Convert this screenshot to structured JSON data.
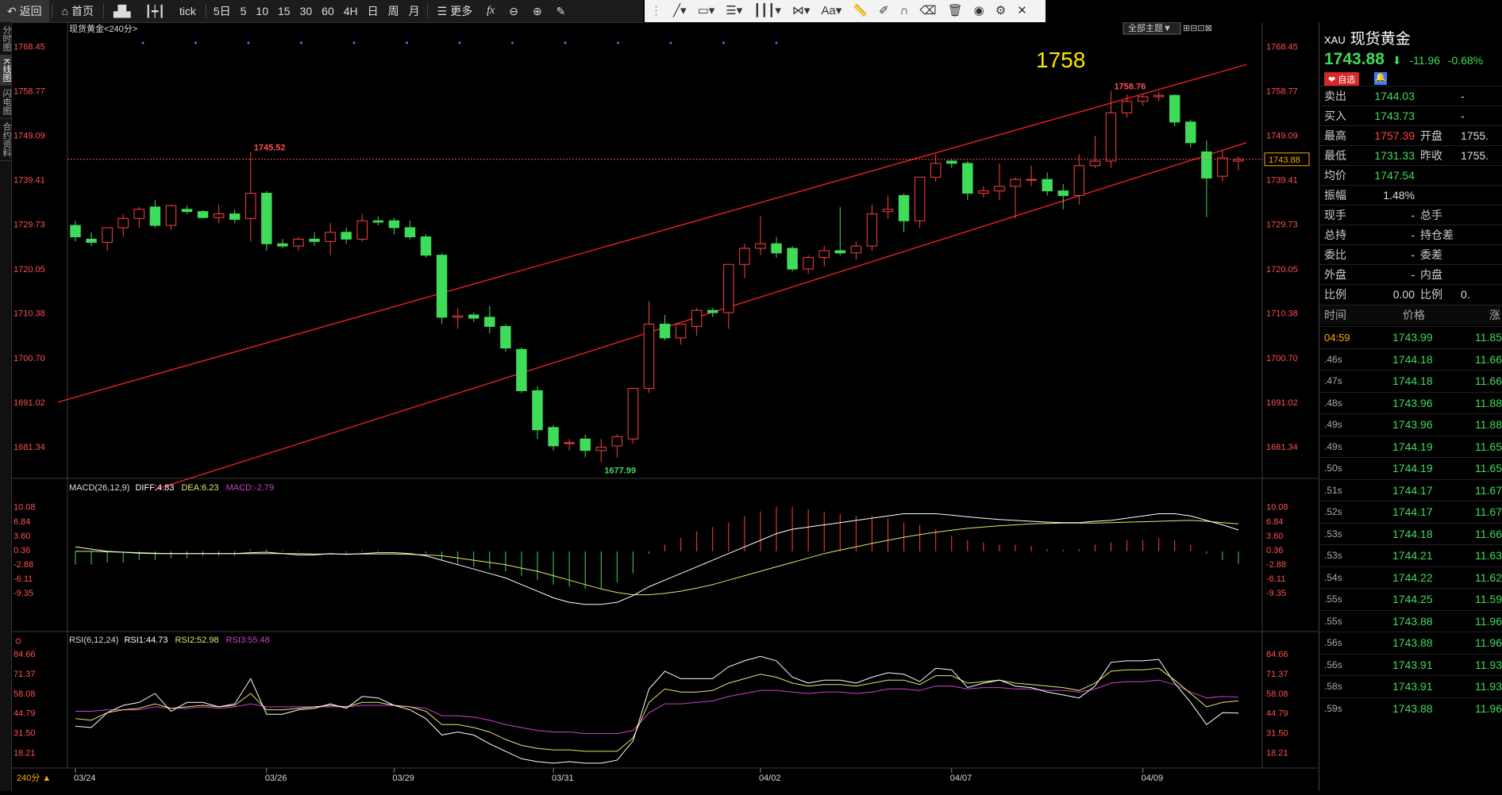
{
  "topbar": {
    "back": "返回",
    "home": "首页",
    "tick": "tick",
    "periods": [
      "5日",
      "5",
      "10",
      "15",
      "30",
      "60",
      "4H",
      "日",
      "周",
      "月"
    ],
    "more": "更多",
    "fx": "fx"
  },
  "drawbar": {
    "font_label": "Aa"
  },
  "left_tabs": [
    "分时图",
    "K线图",
    "闪电图",
    "合约资料"
  ],
  "chart": {
    "symbol_label": "现货黄金<240分>",
    "theme_button": "全部主题▼",
    "big_label": "1758",
    "high_label": "1758.76",
    "low_label": "1677.99",
    "prev_high_label": "1745.52",
    "current_price_tag": "1743.88",
    "price_axis": [
      "1768.45",
      "1758.77",
      "1749.09",
      "1739.41",
      "1729.73",
      "1720.05",
      "1710.38",
      "1700.70",
      "1691.02",
      "1681.34"
    ],
    "dates": [
      "03/24",
      "03/26",
      "03/29",
      "03/31",
      "04/02",
      "04/07",
      "04/09"
    ],
    "period_tag": "240分 ▲",
    "macd_label": "MACD(26,12,9)",
    "macd_diff": "DIFF:4.83",
    "macd_dea": "DEA:6.23",
    "macd_macd": "MACD:-2.79",
    "macd_axis": [
      "10.08",
      "6.84",
      "3.60",
      "0.36",
      "-2.88",
      "-6.11",
      "-9.35"
    ],
    "rsi_label": "RSI(6,12,24)",
    "rsi1": "RSI1:44.73",
    "rsi2": "RSI2:52.98",
    "rsi3": "RSI3:55.48",
    "rsi_axis": [
      "84.66",
      "71.37",
      "58.08",
      "44.79",
      "31.50",
      "18.21"
    ]
  },
  "chart_data": {
    "type": "candlestick",
    "ohlc": [
      [
        1729.5,
        1730.5,
        1726,
        1727
      ],
      [
        1726.5,
        1728,
        1725,
        1725.8
      ],
      [
        1725.8,
        1729,
        1724,
        1729
      ],
      [
        1729,
        1732,
        1727,
        1731
      ],
      [
        1731,
        1733.5,
        1729,
        1733
      ],
      [
        1733.5,
        1735,
        1729,
        1729.5
      ],
      [
        1729.5,
        1734,
        1728.5,
        1733.8
      ],
      [
        1733,
        1733.8,
        1732,
        1732.5
      ],
      [
        1732.5,
        1732.8,
        1731,
        1731.2
      ],
      [
        1731.2,
        1734,
        1730,
        1732
      ],
      [
        1732,
        1733,
        1730,
        1730.8
      ],
      [
        1731,
        1745.5,
        1726,
        1736.5
      ],
      [
        1736.5,
        1737,
        1724,
        1725.5
      ],
      [
        1725.5,
        1726.5,
        1724.5,
        1725
      ],
      [
        1725,
        1727,
        1724,
        1726.5
      ],
      [
        1726.5,
        1728,
        1725,
        1726
      ],
      [
        1726,
        1730,
        1723,
        1728
      ],
      [
        1728,
        1729,
        1725.5,
        1726.5
      ],
      [
        1726.5,
        1732,
        1726,
        1730.5
      ],
      [
        1730.5,
        1731.5,
        1729.5,
        1730.2
      ],
      [
        1730.5,
        1731.2,
        1727.5,
        1729
      ],
      [
        1729,
        1730.5,
        1726.5,
        1727
      ],
      [
        1727,
        1727.5,
        1722.5,
        1723
      ],
      [
        1723,
        1723.5,
        1708,
        1709.5
      ],
      [
        1709.5,
        1711.5,
        1707,
        1709.8
      ],
      [
        1710,
        1710.5,
        1708.5,
        1709.3
      ],
      [
        1709.5,
        1712,
        1706,
        1707.5
      ],
      [
        1707.5,
        1708,
        1702,
        1702.8
      ],
      [
        1702.5,
        1703,
        1693,
        1693.5
      ],
      [
        1693.5,
        1694.5,
        1683,
        1685
      ],
      [
        1685.5,
        1686,
        1680.5,
        1681.5
      ],
      [
        1682,
        1683,
        1680.5,
        1682.2
      ],
      [
        1683,
        1684,
        1679,
        1680.5
      ],
      [
        1680.5,
        1683,
        1677.99,
        1681.2
      ],
      [
        1681.5,
        1684,
        1679,
        1683.5
      ],
      [
        1683,
        1694,
        1682,
        1694
      ],
      [
        1694,
        1713,
        1693,
        1708
      ],
      [
        1708,
        1710,
        1704.5,
        1705
      ],
      [
        1705,
        1708,
        1703.5,
        1708
      ],
      [
        1707.5,
        1711.5,
        1705.5,
        1711
      ],
      [
        1711,
        1711.5,
        1709.5,
        1710.5
      ],
      [
        1710.5,
        1721,
        1707,
        1721
      ],
      [
        1721,
        1725.5,
        1718,
        1724.5
      ],
      [
        1724.5,
        1731.5,
        1723,
        1725.5
      ],
      [
        1725.5,
        1727,
        1722.5,
        1723.5
      ],
      [
        1724.5,
        1725,
        1719.5,
        1720
      ],
      [
        1720,
        1723,
        1719,
        1722.5
      ],
      [
        1722.5,
        1725,
        1720.5,
        1724
      ],
      [
        1724,
        1733.5,
        1723,
        1723.5
      ],
      [
        1723.5,
        1726,
        1722,
        1725
      ],
      [
        1725,
        1734,
        1724,
        1732
      ],
      [
        1732.5,
        1736,
        1731,
        1733
      ],
      [
        1736,
        1736.5,
        1728,
        1730.5
      ],
      [
        1730.5,
        1740,
        1729,
        1740
      ],
      [
        1740,
        1745,
        1739,
        1743
      ],
      [
        1743.5,
        1744,
        1742,
        1743
      ],
      [
        1743,
        1743.5,
        1735,
        1736.5
      ],
      [
        1736.5,
        1738,
        1735.5,
        1737
      ],
      [
        1737,
        1743,
        1735,
        1738
      ],
      [
        1738,
        1740,
        1731,
        1739.5
      ],
      [
        1739.5,
        1742.5,
        1738,
        1739.5
      ],
      [
        1739.5,
        1741,
        1736,
        1737
      ],
      [
        1737,
        1738.5,
        1733,
        1736
      ],
      [
        1736,
        1745,
        1734,
        1742.5
      ],
      [
        1742.5,
        1749,
        1742,
        1743.5
      ],
      [
        1743.5,
        1758.76,
        1742,
        1754
      ],
      [
        1754,
        1758,
        1753,
        1756.5
      ],
      [
        1756.5,
        1758,
        1755.5,
        1757.5
      ],
      [
        1757.5,
        1758.5,
        1756.5,
        1757.8
      ],
      [
        1757.8,
        1758,
        1751,
        1752
      ],
      [
        1752,
        1752.5,
        1746.5,
        1747.5
      ],
      [
        1745.5,
        1748,
        1731.3,
        1739.8
      ],
      [
        1740.2,
        1746,
        1739,
        1744.2
      ],
      [
        1743.5,
        1744.5,
        1741.5,
        1743.88
      ]
    ],
    "ylim": [
      1677,
      1772
    ],
    "dates": [
      "03/24",
      "03/26",
      "03/29",
      "03/31",
      "04/02",
      "04/07",
      "04/09"
    ],
    "macd_hist": [
      -3,
      -3,
      -2.5,
      -2.5,
      -2,
      -2,
      -1.5,
      -1.5,
      -1,
      -1,
      -1,
      0.5,
      0.5,
      0.3,
      0.2,
      0,
      0,
      -0.3,
      0.3,
      0.3,
      0,
      0,
      -0.5,
      -2,
      -3,
      -3.5,
      -4,
      -4.5,
      -5.5,
      -6.5,
      -7.5,
      -8,
      -8.5,
      -8.5,
      -7,
      -5,
      -0.5,
      1.5,
      3,
      4.5,
      5.5,
      6.5,
      8,
      9,
      10.08,
      10,
      9.5,
      9,
      8.5,
      8,
      8,
      7.5,
      6.5,
      6,
      5,
      3.5,
      2.5,
      2,
      1.5,
      1.5,
      1.2,
      0.5,
      0.4,
      0.5,
      1.5,
      2,
      2.5,
      2.5,
      3,
      2.5,
      1.5,
      -0.5,
      -2,
      -2.79
    ],
    "macd_diff": [
      1,
      0.5,
      0,
      -0.2,
      -0.4,
      -0.5,
      -0.5,
      -0.5,
      -0.5,
      -0.5,
      -0.5,
      -0.3,
      -0.2,
      -0.5,
      -0.8,
      -0.8,
      -0.5,
      -0.7,
      -0.5,
      -0.3,
      -0.3,
      -0.5,
      -1,
      -2,
      -3,
      -4,
      -5,
      -6,
      -7.5,
      -9,
      -10.5,
      -11.5,
      -12,
      -12,
      -11.5,
      -10,
      -8,
      -6.5,
      -5,
      -3.5,
      -2,
      -0.5,
      1,
      2.5,
      4,
      5,
      5.5,
      6,
      6.5,
      7,
      7.5,
      8,
      8.5,
      8.5,
      8.5,
      8.2,
      7.8,
      7.5,
      7.2,
      7,
      6.8,
      6.6,
      6.5,
      6.5,
      6.8,
      7,
      7.5,
      8,
      8.5,
      8.5,
      8,
      7,
      6,
      4.83
    ],
    "macd_dea": [
      0,
      0,
      -0.1,
      -0.2,
      -0.3,
      -0.4,
      -0.5,
      -0.5,
      -0.5,
      -0.5,
      -0.5,
      -0.5,
      -0.5,
      -0.5,
      -0.5,
      -0.6,
      -0.6,
      -0.6,
      -0.6,
      -0.6,
      -0.6,
      -0.7,
      -0.8,
      -1,
      -1.5,
      -2,
      -2.5,
      -3,
      -3.8,
      -4.5,
      -5.5,
      -6.5,
      -7.5,
      -8.5,
      -9.3,
      -9.8,
      -9.8,
      -9.5,
      -9,
      -8.3,
      -7.5,
      -6.5,
      -5.5,
      -4.5,
      -3.5,
      -2.5,
      -1.5,
      -0.5,
      0.3,
      1,
      1.8,
      2.5,
      3.2,
      3.8,
      4.3,
      4.8,
      5.2,
      5.5,
      5.8,
      6,
      6.2,
      6.3,
      6.4,
      6.4,
      6.4,
      6.5,
      6.6,
      6.7,
      6.8,
      6.9,
      7,
      6.8,
      6.5,
      6.23
    ],
    "rsi1": [
      36,
      35,
      45,
      50,
      52,
      58,
      46,
      52,
      52,
      49,
      51,
      68,
      44,
      44,
      47,
      48,
      51,
      48,
      56,
      55,
      50,
      47,
      41,
      30,
      32,
      30,
      24,
      19,
      14,
      12,
      11,
      12,
      11,
      11,
      13,
      26,
      61,
      73,
      68,
      68,
      68,
      76,
      80,
      83,
      80,
      69,
      65,
      67,
      67,
      65,
      69,
      72,
      71,
      66,
      75,
      74,
      62,
      65,
      67,
      63,
      62,
      59,
      57,
      55,
      63,
      79,
      80,
      80,
      81,
      65,
      52,
      37,
      45,
      44.73
    ],
    "rsi2": [
      41,
      40,
      45,
      47,
      48,
      51,
      48,
      49,
      50,
      49,
      50,
      58,
      47,
      47,
      48,
      49,
      50,
      49,
      52,
      52,
      50,
      49,
      46,
      37,
      37,
      35,
      32,
      27,
      23,
      21,
      20,
      20,
      19,
      19,
      19,
      28,
      52,
      61,
      59,
      59,
      60,
      65,
      68,
      71,
      69,
      65,
      63,
      64,
      64,
      63,
      65,
      67,
      67,
      64,
      70,
      70,
      65,
      66,
      67,
      65,
      64,
      63,
      62,
      60,
      65,
      73,
      74,
      74,
      75,
      67,
      58,
      49,
      52,
      52.98
    ],
    "rsi3": [
      46,
      46,
      47,
      47,
      47,
      49,
      48,
      48,
      49,
      48,
      49,
      51,
      49,
      49,
      49,
      49,
      49,
      49,
      50,
      50,
      50,
      49,
      48,
      43,
      43,
      42,
      40,
      37,
      35,
      33,
      32,
      32,
      31,
      31,
      31,
      33,
      45,
      51,
      51,
      52,
      53,
      56,
      58,
      60,
      60,
      59,
      58,
      59,
      59,
      58,
      59,
      61,
      61,
      60,
      63,
      63,
      61,
      62,
      62,
      61,
      61,
      60,
      60,
      59,
      61,
      65,
      66,
      66,
      67,
      64,
      59,
      55,
      56,
      55.48
    ],
    "rsi_ylim": [
      12,
      88
    ]
  },
  "right_panel": {
    "code": "XAU",
    "name": "现货黄金",
    "price": "1743.88",
    "arrow": "⬇",
    "change": "-11.96",
    "change_pct": "-0.68%",
    "fav": "❤ 自选",
    "quote": [
      {
        "l1": "卖出",
        "v1": "1744.03",
        "v1c": "green",
        "l2": "",
        "v2": "-"
      },
      {
        "l1": "买入",
        "v1": "1743.73",
        "v1c": "green",
        "l2": "",
        "v2": "-"
      },
      {
        "l1": "最高",
        "v1": "1757.39",
        "v1c": "red",
        "l2": "开盘",
        "v2": "1755."
      },
      {
        "l1": "最低",
        "v1": "1731.33",
        "v1c": "green",
        "l2": "昨收",
        "v2": "1755."
      },
      {
        "l1": "均价",
        "v1": "1747.54",
        "v1c": "green",
        "l2": "",
        "v2": ""
      },
      {
        "l1": "振幅",
        "v1": "1.48%",
        "v1c": "white",
        "l2": "",
        "v2": ""
      },
      {
        "l1": "现手",
        "v1": "-",
        "v1c": "white",
        "l2": "总手",
        "v2": ""
      },
      {
        "l1": "总持",
        "v1": "-",
        "v1c": "white",
        "l2": "持仓差",
        "v2": ""
      },
      {
        "l1": "委比",
        "v1": "-",
        "v1c": "white",
        "l2": "委差",
        "v2": ""
      },
      {
        "l1": "外盘",
        "v1": "-",
        "v1c": "white",
        "l2": "内盘",
        "v2": ""
      },
      {
        "l1": "比例",
        "v1": "0.00",
        "v1c": "white",
        "l2": "比例",
        "v2": "0."
      }
    ],
    "tick_header": {
      "time": "时间",
      "price": "价格",
      "vol": "涨"
    },
    "ticks": [
      {
        "t": "04:59",
        "p": "1743.99",
        "v": "11.85"
      },
      {
        "t": ".46s",
        "p": "1744.18",
        "v": "11.66"
      },
      {
        "t": ".47s",
        "p": "1744.18",
        "v": "11.66"
      },
      {
        "t": ".48s",
        "p": "1743.96",
        "v": "11.88"
      },
      {
        "t": ".49s",
        "p": "1743.96",
        "v": "11.88"
      },
      {
        "t": ".49s",
        "p": "1744.19",
        "v": "11.65"
      },
      {
        "t": ".50s",
        "p": "1744.19",
        "v": "11.65"
      },
      {
        "t": ".51s",
        "p": "1744.17",
        "v": "11.67"
      },
      {
        "t": ".52s",
        "p": "1744.17",
        "v": "11.67"
      },
      {
        "t": ".53s",
        "p": "1744.18",
        "v": "11.66"
      },
      {
        "t": ".53s",
        "p": "1744.21",
        "v": "11.63"
      },
      {
        "t": ".54s",
        "p": "1744.22",
        "v": "11.62"
      },
      {
        "t": ".55s",
        "p": "1744.25",
        "v": "11.59"
      },
      {
        "t": ".55s",
        "p": "1743.88",
        "v": "11.96"
      },
      {
        "t": ".56s",
        "p": "1743.88",
        "v": "11.96"
      },
      {
        "t": ".56s",
        "p": "1743.91",
        "v": "11.93"
      },
      {
        "t": ".58s",
        "p": "1743.91",
        "v": "11.93"
      },
      {
        "t": ".59s",
        "p": "1743.88",
        "v": "11.96"
      }
    ]
  }
}
